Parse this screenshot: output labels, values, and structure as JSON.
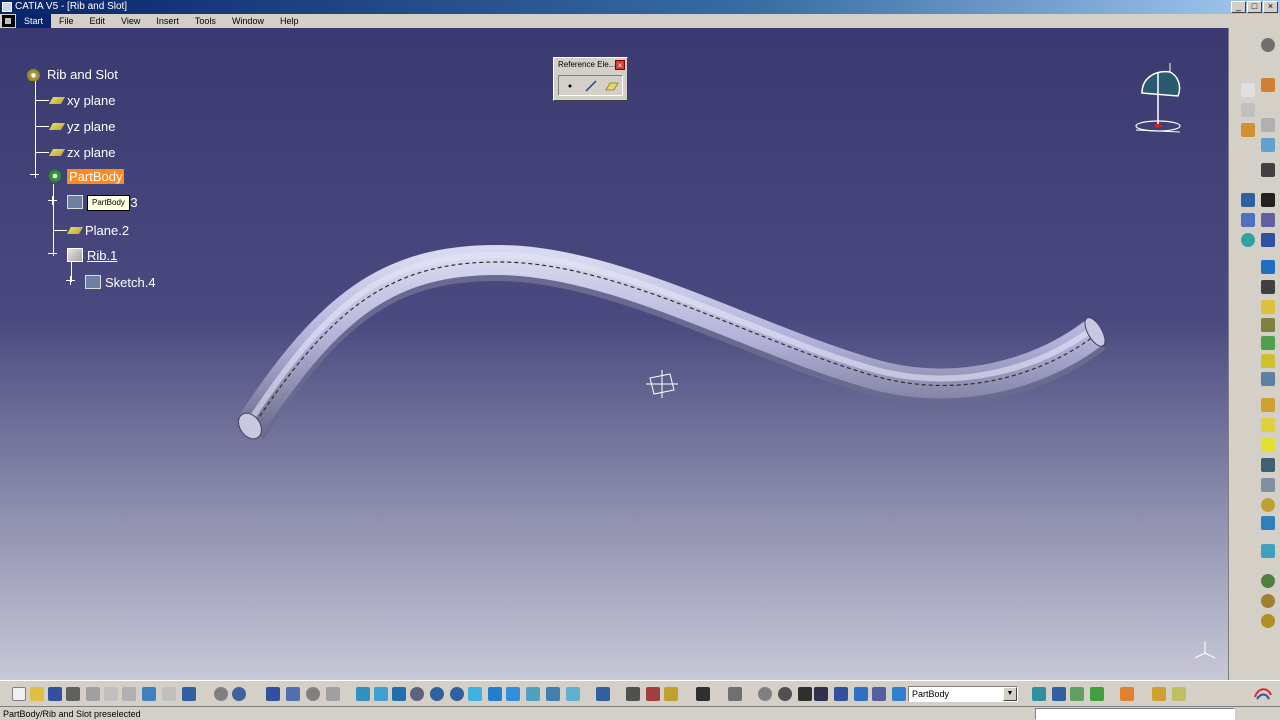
{
  "window": {
    "title": "CATIA V5 - [Rib and Slot]",
    "minimize": "_",
    "maximize": "□",
    "close": "×"
  },
  "menu": {
    "items": [
      "Start",
      "File",
      "Edit",
      "View",
      "Insert",
      "Tools",
      "Window",
      "Help"
    ]
  },
  "tree": {
    "root": "Rib and Slot",
    "xy_plane": "xy plane",
    "yz_plane": "yz plane",
    "zx_plane": "zx plane",
    "partbody": "PartBody",
    "sketch3": "Sketch.3",
    "plane2": "Plane.2",
    "rib1": "Rib.1",
    "sketch4": "Sketch.4",
    "tooltip": "PartBody"
  },
  "reference_toolbar": {
    "title": "Reference Ele...",
    "close": "×"
  },
  "bottom_toolbar": {
    "body_select_value": "PartBody",
    "select_arrow": "▼"
  },
  "status": {
    "text": "PartBody/Rib and Slot preselected"
  },
  "colors": {
    "viewport_top": "#3a3a70",
    "viewport_bottom": "#c8c8d8",
    "selection_orange": "#ff8a1a",
    "tube_fill": "#b0b0d8"
  }
}
